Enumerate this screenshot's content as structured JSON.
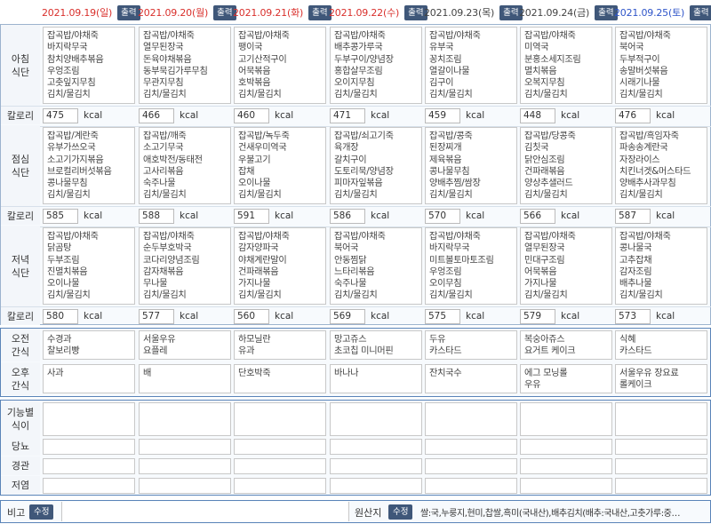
{
  "days": [
    {
      "date": "2021.09.19(일)",
      "color": "#d9302c"
    },
    {
      "date": "2021.09.20(월)",
      "color": "#d9302c"
    },
    {
      "date": "2021.09.21(화)",
      "color": "#d9302c"
    },
    {
      "date": "2021.09.22(수)",
      "color": "#d9302c"
    },
    {
      "date": "2021.09.23(목)",
      "color": "#444444"
    },
    {
      "date": "2021.09.24(금)",
      "color": "#444444"
    },
    {
      "date": "2021.09.25(토)",
      "color": "#2f55c9"
    }
  ],
  "print_label": "출력",
  "calorie_label": "칼로리",
  "kcal_unit": "kcal",
  "meals": [
    {
      "label": "아침\n식단",
      "menus": [
        "잡곡밥/야채죽\n바지락무국\n참치양배추볶음\n우엉조림\n고춧잎지무침\n김치/물김치",
        "잡곡밥/야채죽\n열무된장국\n돈육야채볶음\n동부묵김가루무침\n무관지무침\n김치/물김치",
        "잡곡밥/야채죽\n팽이국\n고기산적구이\n어묵볶음\n호박볶음\n김치/물김치",
        "잡곡밥/야채죽\n배추콩가루국\n두부구이/양념장\n홍합살무조림\n오이지무침\n김치/물김치",
        "잡곡밥/야채죽\n유부국\n꽁치조림\n열갈이나물\n김구이\n김치/물김치",
        "잡곡밥/야채죽\n미역국\n분홍소세지조림\n멸치볶음\n오복지무침\n김치/물김치",
        "잡곡밥/야채죽\n북어국\n두부적구이\n송말버섯볶음\n시래기나물\n김치/물김치"
      ],
      "calories": [
        "475",
        "466",
        "460",
        "471",
        "459",
        "448",
        "476"
      ]
    },
    {
      "label": "점심\n식단",
      "menus": [
        "잡곡밥/계란죽\n유부가쓰오국\n소고기가지볶음\n브로컬리버섯볶음\n콩나물무침\n김치/물김치",
        "잡곡밥/깨죽\n소고기무국\n애호박전/동태전\n고사리볶음\n숙주나물\n김치/물김치",
        "잡곡밥/녹두죽\n건새우미역국\n우불고기\n잡채\n오이나물\n김치/물김치",
        "잡곡밥/쇠고기죽\n육개장\n갈치구이\n도토리묵/양념장\n피마자잎볶음\n김치/물김치",
        "잡곡밥/콩죽\n된장찌개\n제육볶음\n콩나물무침\n양배추찜/쌈장\n김치/물김치",
        "잡곡밥/당콩죽\n김칫국\n닭안심조림\n건파래볶음\n양상추샐러드\n김치/물김치",
        "잡곡밥/흑임자죽\n파송송계란국\n자장라이스\n치킨너겟&머스타드\n양배추사과무침\n김치/물김치"
      ],
      "calories": [
        "585",
        "588",
        "591",
        "586",
        "570",
        "566",
        "587"
      ]
    },
    {
      "label": "저녁\n식단",
      "menus": [
        "잡곡밥/야채죽\n닭곰탕\n두부조림\n진멸치볶음\n오이나물\n김치/물김치",
        "잡곡밥/야채죽\n순두부호박국\n코다리양념조림\n감자채볶음\n무나물\n김치/물김치",
        "잡곡밥/야채죽\n감자양파국\n야채계란말이\n건파래볶음\n가지나물\n김치/물김치",
        "잡곡밥/야채죽\n북어국\n안동찜닭\n느타리볶음\n숙주나물\n김치/물김치",
        "잡곡밥/야채죽\n바지락무국\n미트볼토마토조림\n우엉조림\n오이무침\n김치/물김치",
        "잡곡밥/야채죽\n열무된장국\n민대구조림\n어묵볶음\n가지나물\n김치/물김치",
        "잡곡밥/야채죽\n콩나물국\n고추잡채\n감자조림\n배추나물\n김치/물김치"
      ],
      "calories": [
        "580",
        "577",
        "560",
        "569",
        "575",
        "579",
        "573"
      ]
    }
  ],
  "snacks": [
    {
      "label": "오전\n간식",
      "items": [
        "수경과\n찰보리빵",
        "서울우유\n요플레",
        "하모닐란\n유과",
        "망고쥬스\n초코칩 미니머핀",
        "두유\n카스타드",
        "복숭아쥬스\n요거트 케이크",
        "식혜\n카스타드"
      ]
    },
    {
      "label": "오후\n간식",
      "items": [
        "사과",
        "배",
        "단호박죽",
        "바나나",
        "잔치국수",
        "에그 모닝롤\n우유",
        "서울우유 장요료\n롤케이크"
      ]
    }
  ],
  "special_rows": [
    {
      "label": "기능별\n식이"
    },
    {
      "label": "당뇨"
    },
    {
      "label": "경관"
    },
    {
      "label": "저염"
    }
  ],
  "footer": {
    "note_label": "비고",
    "edit_label": "수정",
    "origin_label": "원산지",
    "origin_text": "쌀:국,누룽지,현미,찹쌀,흑미(국내산),배추김치(배추:국내산,고춧가루:중…"
  }
}
